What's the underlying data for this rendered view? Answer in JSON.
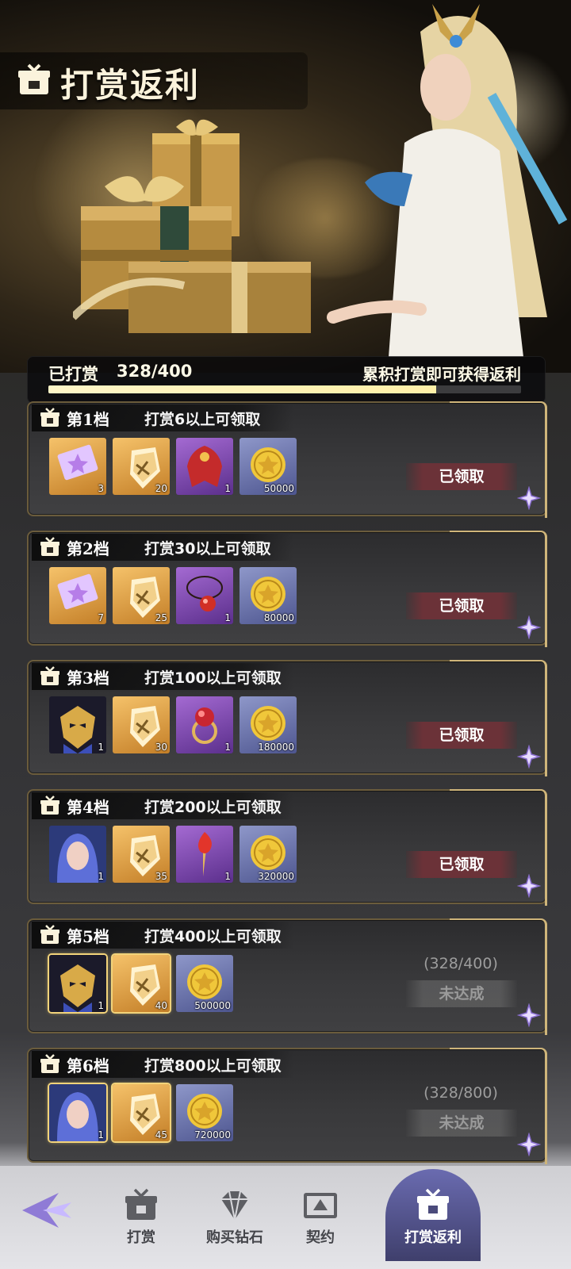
{
  "page": {
    "title": "打赏返利"
  },
  "progress": {
    "label": "已打赏",
    "value": "328/400",
    "current": 328,
    "target": 400,
    "hint": "累积打赏即可获得返利"
  },
  "colors": {
    "accent": "#cfb57a",
    "claimed": "#6b3238",
    "progress_fill": "#fff3b8",
    "nav_active": "#55568f"
  },
  "tiers": [
    {
      "name": "第1档",
      "condition": "打赏6以上可领取",
      "status": "已领取",
      "status_state": "claimed",
      "progress_text": "",
      "items": [
        {
          "icon": "summon-ticket-icon",
          "qty": "3",
          "quality": "gold"
        },
        {
          "icon": "gold-shard-icon",
          "qty": "20",
          "quality": "gold"
        },
        {
          "icon": "red-cloak-icon",
          "qty": "1",
          "quality": "purple"
        },
        {
          "icon": "gold-coin-icon",
          "qty": "50000",
          "quality": "blue"
        }
      ]
    },
    {
      "name": "第2档",
      "condition": "打赏30以上可领取",
      "status": "已领取",
      "status_state": "claimed",
      "progress_text": "",
      "items": [
        {
          "icon": "summon-ticket-icon",
          "qty": "7",
          "quality": "gold"
        },
        {
          "icon": "gold-shard-icon",
          "qty": "25",
          "quality": "gold"
        },
        {
          "icon": "red-amulet-icon",
          "qty": "1",
          "quality": "purple"
        },
        {
          "icon": "gold-coin-icon",
          "qty": "80000",
          "quality": "blue"
        }
      ]
    },
    {
      "name": "第3档",
      "condition": "打赏100以上可领取",
      "status": "已领取",
      "status_state": "claimed",
      "progress_text": "",
      "items": [
        {
          "icon": "golden-mask-portrait-icon",
          "qty": "1",
          "quality": "dark"
        },
        {
          "icon": "gold-shard-icon",
          "qty": "30",
          "quality": "gold"
        },
        {
          "icon": "ruby-ring-icon",
          "qty": "1",
          "quality": "purple"
        },
        {
          "icon": "gold-coin-icon",
          "qty": "180000",
          "quality": "blue"
        }
      ]
    },
    {
      "name": "第4档",
      "condition": "打赏200以上可领取",
      "status": "已领取",
      "status_state": "claimed",
      "progress_text": "",
      "items": [
        {
          "icon": "blue-hair-portrait-icon",
          "qty": "1",
          "quality": "portrait"
        },
        {
          "icon": "gold-shard-icon",
          "qty": "35",
          "quality": "gold"
        },
        {
          "icon": "flame-scepter-icon",
          "qty": "1",
          "quality": "purple"
        },
        {
          "icon": "gold-coin-icon",
          "qty": "320000",
          "quality": "blue"
        }
      ]
    },
    {
      "name": "第5档",
      "condition": "打赏400以上可领取",
      "status": "未达成",
      "status_state": "locked",
      "progress_text": "(328/400)",
      "items": [
        {
          "icon": "golden-mask-portrait-icon",
          "qty": "1",
          "quality": "dark",
          "framed": true
        },
        {
          "icon": "gold-shard-icon",
          "qty": "40",
          "quality": "gold",
          "framed": true
        },
        {
          "icon": "gold-coin-icon",
          "qty": "500000",
          "quality": "blue"
        }
      ]
    },
    {
      "name": "第6档",
      "condition": "打赏800以上可领取",
      "status": "未达成",
      "status_state": "locked",
      "progress_text": "(328/800)",
      "items": [
        {
          "icon": "blue-hair-portrait-icon",
          "qty": "1",
          "quality": "portrait",
          "framed": true
        },
        {
          "icon": "gold-shard-icon",
          "qty": "45",
          "quality": "gold",
          "framed": true
        },
        {
          "icon": "gold-coin-icon",
          "qty": "720000",
          "quality": "blue"
        }
      ]
    }
  ],
  "nav": {
    "home_icon": "back-star-icon",
    "items": [
      {
        "label": "打赏",
        "icon": "gift-box-icon",
        "active": false
      },
      {
        "label": "购买钻石",
        "icon": "diamond-icon",
        "active": false
      },
      {
        "label": "契约",
        "icon": "contract-icon",
        "active": false
      },
      {
        "label": "打赏返利",
        "icon": "gift-box-icon",
        "active": true
      }
    ]
  }
}
